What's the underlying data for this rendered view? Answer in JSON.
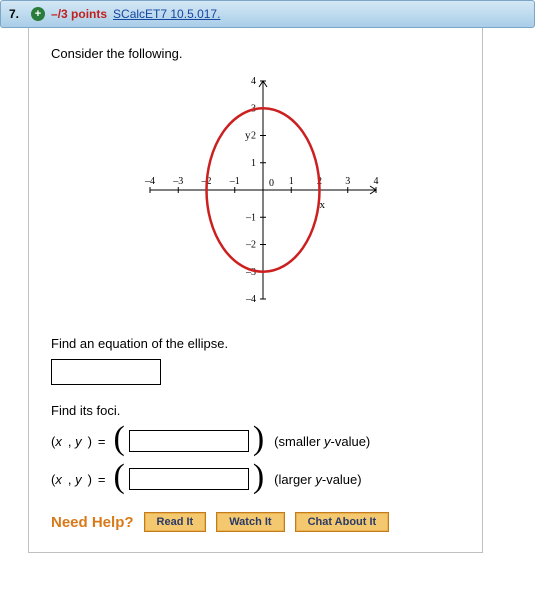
{
  "header": {
    "number": "7.",
    "points": "–/3 points",
    "source": "SCalcET7 10.5.017."
  },
  "prompt": "Consider the following.",
  "chart_data": {
    "type": "scatter",
    "title": "",
    "xlabel": "x",
    "ylabel": "y",
    "xlim": [
      -4,
      4
    ],
    "ylim": [
      -4,
      4
    ],
    "xticks": [
      -4,
      -3,
      -2,
      -1,
      0,
      1,
      2,
      3,
      4
    ],
    "yticks": [
      -4,
      -3,
      -2,
      -1,
      0,
      1,
      2,
      3,
      4
    ],
    "series": [
      {
        "name": "ellipse",
        "shape": "ellipse",
        "center": [
          0,
          0
        ],
        "rx": 2,
        "ry": 3,
        "color": "#cc1f1f"
      }
    ]
  },
  "sect1": "Find an equation of the ellipse.",
  "sect2": "Find its foci.",
  "xy_label": "(x, y)",
  "equals": "=",
  "hint1": "(smaller y-value)",
  "hint2": "(larger y-value)",
  "help": {
    "label": "Need Help?",
    "btn_read": "Read It",
    "btn_watch": "Watch It",
    "btn_chat": "Chat About It"
  }
}
